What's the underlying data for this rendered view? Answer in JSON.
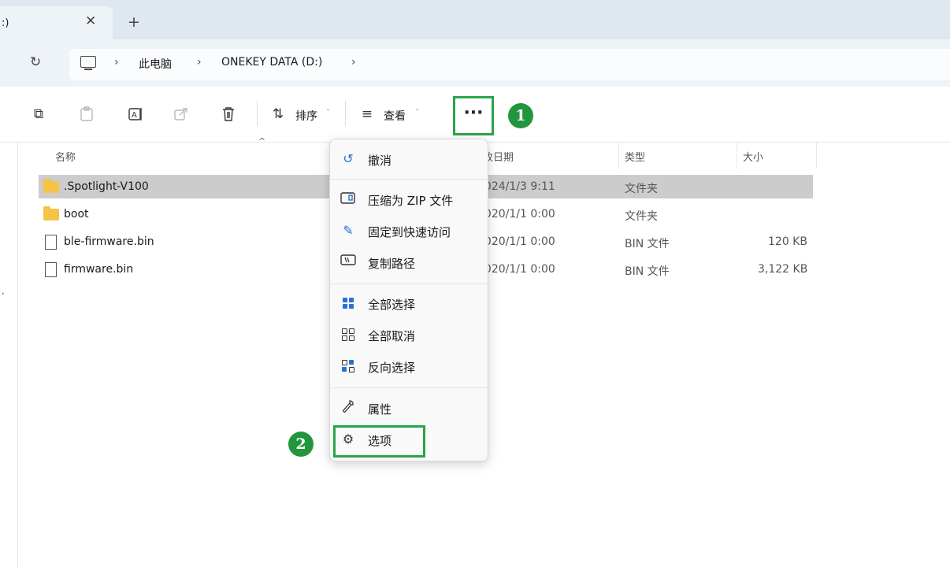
{
  "tab": {
    "title": ":)",
    "close": "✕",
    "new_tab": "+"
  },
  "address": {
    "refresh": "↻",
    "sep": "›",
    "crumbs": [
      "此电脑",
      "ONEKEY DATA (D:)"
    ]
  },
  "toolbar": {
    "sort_label": "排序",
    "view_label": "查看",
    "more_label": "···",
    "chevron": "˅",
    "step1": "1",
    "step2": "2"
  },
  "headers": {
    "name": "名称",
    "modified": "修改日期",
    "type": "类型",
    "size": "大小",
    "sort_caret": "^"
  },
  "files": [
    {
      "name": ".Spotlight-V100",
      "kind": "folder",
      "modified": "2024/1/3 9:11",
      "type": "文件夹",
      "size": ""
    },
    {
      "name": "boot",
      "kind": "folder",
      "modified": "2020/1/1 0:00",
      "type": "文件夹",
      "size": ""
    },
    {
      "name": "ble-firmware.bin",
      "kind": "file",
      "modified": "2020/1/1 0:00",
      "type": "BIN 文件",
      "size": "120 KB"
    },
    {
      "name": "firmware.bin",
      "kind": "file",
      "modified": "2020/1/1 0:00",
      "type": "BIN 文件",
      "size": "3,122 KB"
    }
  ],
  "menu": {
    "undo": "撤消",
    "zip": "压缩为 ZIP 文件",
    "pin": "固定到快速访问",
    "copy_path": "复制路径",
    "select_all": "全部选择",
    "select_none": "全部取消",
    "invert": "反向选择",
    "properties": "属性",
    "options": "选项"
  },
  "colors": {
    "highlight_green": "#2aa44a",
    "badge_green": "#21963d",
    "folder": "#f5c346",
    "selection": "#cccccc"
  }
}
